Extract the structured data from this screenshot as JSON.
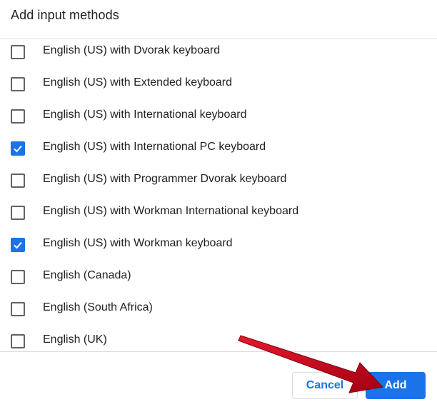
{
  "dialog": {
    "title": "Add input methods",
    "items": [
      {
        "label": "English (US) with Dvorak keyboard",
        "checked": false
      },
      {
        "label": "English (US) with Extended keyboard",
        "checked": false
      },
      {
        "label": "English (US) with International keyboard",
        "checked": false
      },
      {
        "label": "English (US) with International PC keyboard",
        "checked": true
      },
      {
        "label": "English (US) with Programmer Dvorak keyboard",
        "checked": false
      },
      {
        "label": "English (US) with Workman International keyboard",
        "checked": false
      },
      {
        "label": "English (US) with Workman keyboard",
        "checked": true
      },
      {
        "label": "English (Canada)",
        "checked": false
      },
      {
        "label": "English (South Africa)",
        "checked": false
      },
      {
        "label": "English (UK)",
        "checked": false
      }
    ],
    "buttons": {
      "cancel_label": "Cancel",
      "add_label": "Add"
    }
  },
  "colors": {
    "accent": "#1a73e8",
    "checkbox_border": "#5f6368",
    "divider": "#dadce0",
    "annotation_arrow": "#d0021b"
  },
  "annotation": {
    "arrow_target": "add-button"
  }
}
